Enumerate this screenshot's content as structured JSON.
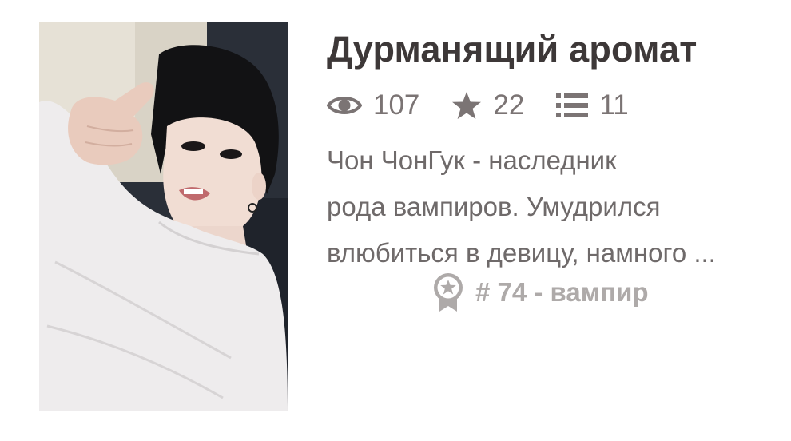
{
  "story": {
    "title": "Дурманящий аромат",
    "stats": {
      "views": "107",
      "stars": "22",
      "chapters": "11"
    },
    "description": [
      "Чон ЧонГук - наследник",
      "рода вампиров. Умудрился",
      "влюбиться в девицу, намного ..."
    ],
    "rank": {
      "text": "# 74 - вампир"
    }
  },
  "icons": {
    "views": "eye-icon",
    "stars": "star-icon",
    "chapters": "list-icon",
    "rank": "award-badge-icon"
  },
  "colors": {
    "title": "#3d3838",
    "stats": "#7b7474",
    "description": "#6f6a6a",
    "rank": "#aeaaa9"
  }
}
